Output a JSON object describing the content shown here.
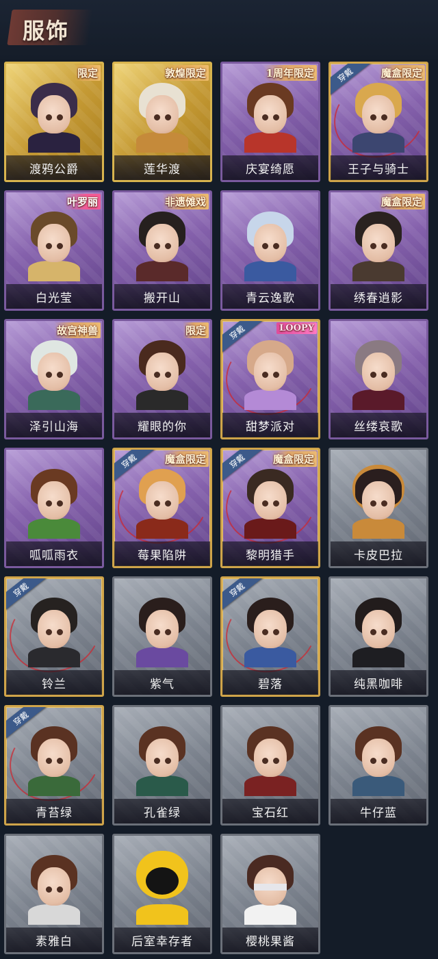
{
  "header": {
    "title": "服饰"
  },
  "labels": {
    "equipped": "穿戴"
  },
  "colors": {
    "background": "#141c28",
    "gold": "#d8b44e",
    "purple": "#8561ac",
    "grey": "#7c838e",
    "equip_ribbon": "#3c5a8a"
  },
  "outfits": [
    {
      "name": "渡鸦公爵",
      "tier": "gold",
      "tag": "限定",
      "equipped": false,
      "hair": "#3b2d4a",
      "outfit": "#2a2240"
    },
    {
      "name": "莲华渡",
      "tier": "gold",
      "tag": "敦煌限定",
      "equipped": false,
      "hair": "#e8e1d2",
      "outfit": "#c58a3a"
    },
    {
      "name": "庆宴绮愿",
      "tier": "purple",
      "tag": "1周年限定",
      "equipped": false,
      "hair": "#6a3a22",
      "outfit": "#b8352a"
    },
    {
      "name": "王子与骑士",
      "tier": "purple",
      "tag": "魔盒限定",
      "equipped": true,
      "hair": "#d9a84e",
      "outfit": "#3c4670"
    },
    {
      "name": "白光莹",
      "tier": "purple",
      "tag": "叶罗丽",
      "equipped": false,
      "hair": "#6a4a2a",
      "outfit": "#d6b46a"
    },
    {
      "name": "搬开山",
      "tier": "purple",
      "tag": "非遗傩戏",
      "equipped": false,
      "hair": "#26201e",
      "outfit": "#5a2a2a"
    },
    {
      "name": "青云逸歌",
      "tier": "purple",
      "tag": "",
      "equipped": false,
      "hair": "#c7d6ea",
      "outfit": "#3a5aa0"
    },
    {
      "name": "绣春逍影",
      "tier": "purple",
      "tag": "魔盒限定",
      "equipped": false,
      "hair": "#2a2220",
      "outfit": "#4a3a30"
    },
    {
      "name": "泽引山海",
      "tier": "purple",
      "tag": "故宫神兽",
      "equipped": false,
      "hair": "#dfe6e2",
      "outfit": "#3a6a5a"
    },
    {
      "name": "耀眼的你",
      "tier": "purple",
      "tag": "限定",
      "equipped": false,
      "hair": "#4a2a1e",
      "outfit": "#2a2a2a"
    },
    {
      "name": "甜梦派对",
      "tier": "purple",
      "tag": "LOOPY",
      "equipped": true,
      "hair": "#d6a98a",
      "outfit": "#b48ad6"
    },
    {
      "name": "丝缕哀歌",
      "tier": "purple",
      "tag": "",
      "equipped": false,
      "hair": "#8a7a82",
      "outfit": "#5a1a2a"
    },
    {
      "name": "呱呱雨衣",
      "tier": "purple",
      "tag": "",
      "equipped": false,
      "hair": "#6a3a22",
      "outfit": "#4a8a3a"
    },
    {
      "name": "莓果陷阱",
      "tier": "purple",
      "tag": "魔盒限定",
      "equipped": true,
      "hair": "#e0a050",
      "outfit": "#8a2a1a"
    },
    {
      "name": "黎明猎手",
      "tier": "purple",
      "tag": "魔盒限定",
      "equipped": true,
      "hair": "#3a2a22",
      "outfit": "#6a1a1a"
    },
    {
      "name": "卡皮巴拉",
      "tier": "grey",
      "tag": "",
      "equipped": false,
      "hair": "#2a1e1e",
      "outfit": "#c98a3a"
    },
    {
      "name": "铃兰",
      "tier": "grey",
      "tag": "",
      "equipped": true,
      "hair": "#262220",
      "outfit": "#2a2a2e"
    },
    {
      "name": "紫气",
      "tier": "grey",
      "tag": "",
      "equipped": false,
      "hair": "#2a1e1c",
      "outfit": "#6a4aa0"
    },
    {
      "name": "碧落",
      "tier": "grey",
      "tag": "",
      "equipped": true,
      "hair": "#2a1e1c",
      "outfit": "#3a5aa0"
    },
    {
      "name": "纯黑咖啡",
      "tier": "grey",
      "tag": "",
      "equipped": false,
      "hair": "#221c1c",
      "outfit": "#1e1e22"
    },
    {
      "name": "青苔绿",
      "tier": "grey",
      "tag": "",
      "equipped": true,
      "hair": "#5a3222",
      "outfit": "#3a6a3a"
    },
    {
      "name": "孔雀绿",
      "tier": "grey",
      "tag": "",
      "equipped": false,
      "hair": "#5a3222",
      "outfit": "#2a5a4a"
    },
    {
      "name": "宝石红",
      "tier": "grey",
      "tag": "",
      "equipped": false,
      "hair": "#5a3222",
      "outfit": "#7a2222"
    },
    {
      "name": "牛仔蓝",
      "tier": "grey",
      "tag": "",
      "equipped": false,
      "hair": "#5a3222",
      "outfit": "#3a5a7a"
    },
    {
      "name": "素雅白",
      "tier": "grey",
      "tag": "",
      "equipped": false,
      "hair": "#5a3222",
      "outfit": "#d8d8d8"
    },
    {
      "name": "后室幸存者",
      "tier": "grey",
      "tag": "",
      "equipped": false,
      "hair": "#f1c31c",
      "outfit": "#f1c31c"
    },
    {
      "name": "樱桃果酱",
      "tier": "grey",
      "tag": "",
      "equipped": false,
      "hair": "#4a2a22",
      "outfit": "#f2f2f2"
    }
  ]
}
